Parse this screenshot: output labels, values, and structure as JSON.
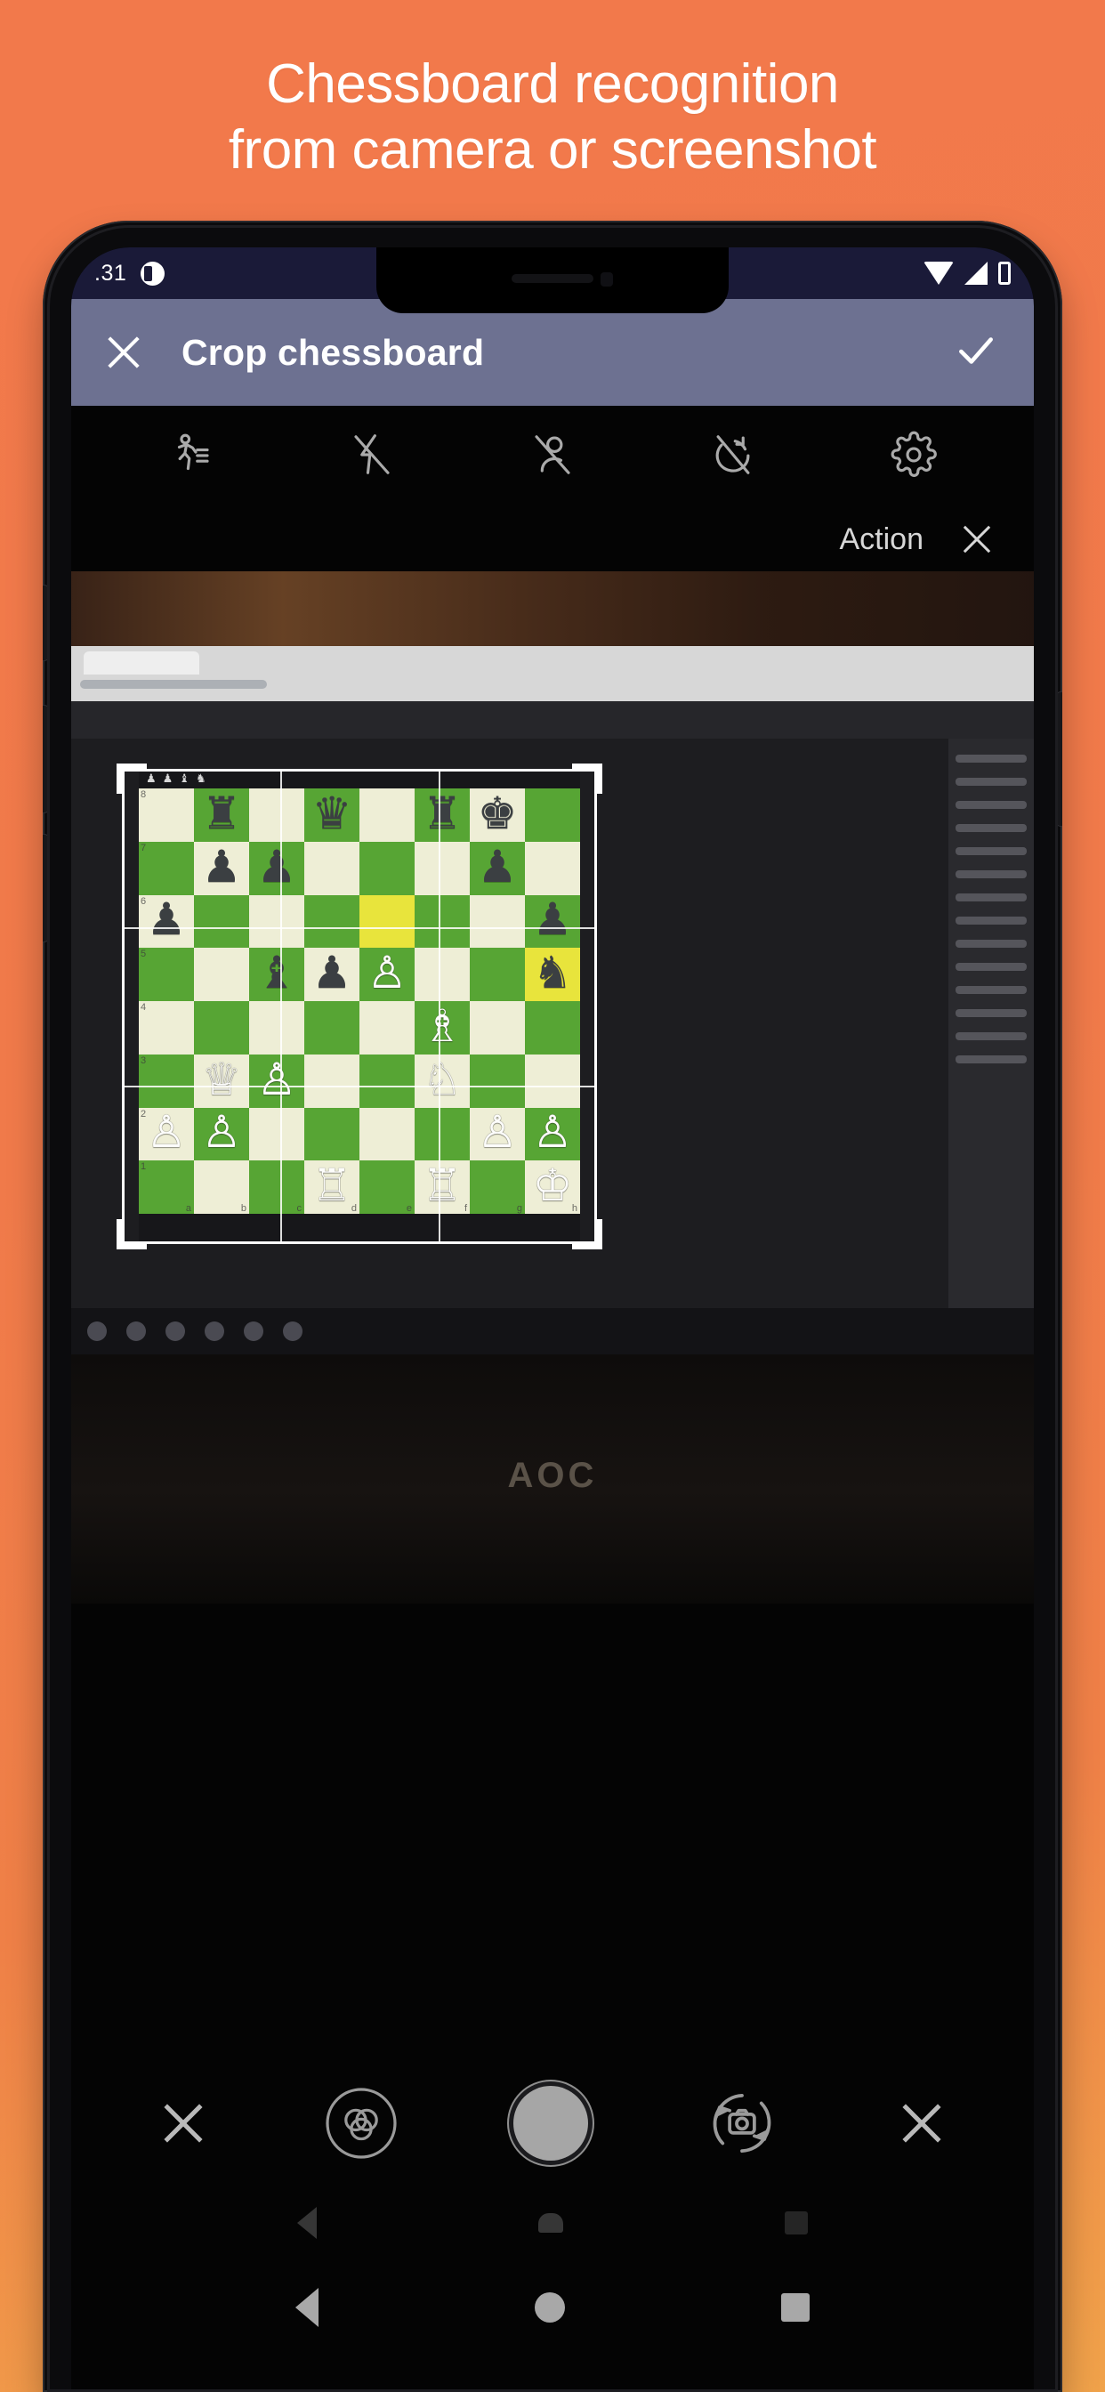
{
  "promo": {
    "line1": "Chessboard recognition",
    "line2": "from camera or screenshot",
    "background_color": "#f0794a",
    "text_color": "#ffffff"
  },
  "phone": {
    "status_bar": {
      "clock": ".31",
      "background_color": "#1a1a38",
      "left_icons": [
        "app-badge-icon"
      ],
      "right_icons": [
        "wifi-icon",
        "signal-icon",
        "battery-icon"
      ]
    },
    "app_bar": {
      "title": "Crop chessboard",
      "close_label": "close-icon",
      "confirm_label": "check-icon",
      "background_color": "#6d7191",
      "text_color": "#ffffff"
    },
    "camera_toolbar": {
      "items": [
        {
          "name": "motion-photo-off-icon"
        },
        {
          "name": "flash-off-icon"
        },
        {
          "name": "portrait-off-icon"
        },
        {
          "name": "timer-off-icon"
        },
        {
          "name": "settings-gear-icon"
        }
      ]
    },
    "action_row": {
      "label": "Action",
      "close_label": "close-icon"
    },
    "camera_controls": {
      "close_label": "close-icon",
      "filters_label": "filters-icon",
      "shutter_label": "shutter-button",
      "flip_label": "flip-camera-icon",
      "cancel_label": "close-icon"
    },
    "nav_bar": {
      "back_label": "back-triangle-icon",
      "home_label": "home-circle-icon",
      "recents_label": "recents-square-icon"
    }
  },
  "scene": {
    "monitor_brand": "AOC",
    "browser_url": "",
    "move_lines": 14,
    "taskbar_dots": 6
  },
  "crop": {
    "frame_color": "#ffffff",
    "grid": true
  },
  "chessboard": {
    "light_square_color": "#eeeed6",
    "dark_square_color": "#57a534",
    "highlight_color": "#e8e43c",
    "file_labels": [
      "a",
      "b",
      "c",
      "d",
      "e",
      "f",
      "g",
      "h"
    ],
    "rank_labels": [
      "8",
      "7",
      "6",
      "5",
      "4",
      "3",
      "2",
      "1"
    ],
    "captured_strip": [
      "♟",
      "♟",
      "♝",
      "♞"
    ],
    "highlighted_squares": [
      "e6",
      "h5"
    ],
    "ranks": [
      {
        "rank": "8",
        "squares": [
          {
            "piece": "",
            "color": ""
          },
          {
            "piece": "♜",
            "color": "black"
          },
          {
            "piece": "",
            "color": ""
          },
          {
            "piece": "♛",
            "color": "black"
          },
          {
            "piece": "",
            "color": ""
          },
          {
            "piece": "♜",
            "color": "black"
          },
          {
            "piece": "♚",
            "color": "black"
          },
          {
            "piece": "",
            "color": ""
          }
        ]
      },
      {
        "rank": "7",
        "squares": [
          {
            "piece": "",
            "color": ""
          },
          {
            "piece": "♟",
            "color": "black"
          },
          {
            "piece": "♟",
            "color": "black"
          },
          {
            "piece": "",
            "color": ""
          },
          {
            "piece": "",
            "color": ""
          },
          {
            "piece": "",
            "color": ""
          },
          {
            "piece": "♟",
            "color": "black"
          },
          {
            "piece": "",
            "color": ""
          }
        ]
      },
      {
        "rank": "6",
        "squares": [
          {
            "piece": "♟",
            "color": "black"
          },
          {
            "piece": "",
            "color": ""
          },
          {
            "piece": "",
            "color": ""
          },
          {
            "piece": "",
            "color": ""
          },
          {
            "piece": "",
            "color": "",
            "highlight": true
          },
          {
            "piece": "",
            "color": ""
          },
          {
            "piece": "",
            "color": ""
          },
          {
            "piece": "♟",
            "color": "black"
          }
        ]
      },
      {
        "rank": "5",
        "squares": [
          {
            "piece": "",
            "color": ""
          },
          {
            "piece": "",
            "color": ""
          },
          {
            "piece": "♝",
            "color": "black"
          },
          {
            "piece": "♟",
            "color": "black"
          },
          {
            "piece": "♙",
            "color": "white"
          },
          {
            "piece": "",
            "color": ""
          },
          {
            "piece": "",
            "color": ""
          },
          {
            "piece": "♞",
            "color": "black",
            "highlight": true
          }
        ]
      },
      {
        "rank": "4",
        "squares": [
          {
            "piece": "",
            "color": ""
          },
          {
            "piece": "",
            "color": ""
          },
          {
            "piece": "",
            "color": ""
          },
          {
            "piece": "",
            "color": ""
          },
          {
            "piece": "",
            "color": ""
          },
          {
            "piece": "♗",
            "color": "white"
          },
          {
            "piece": "",
            "color": ""
          },
          {
            "piece": "",
            "color": ""
          }
        ]
      },
      {
        "rank": "3",
        "squares": [
          {
            "piece": "",
            "color": ""
          },
          {
            "piece": "♕",
            "color": "white"
          },
          {
            "piece": "♙",
            "color": "white"
          },
          {
            "piece": "",
            "color": ""
          },
          {
            "piece": "",
            "color": ""
          },
          {
            "piece": "♘",
            "color": "white"
          },
          {
            "piece": "",
            "color": ""
          },
          {
            "piece": "",
            "color": ""
          }
        ]
      },
      {
        "rank": "2",
        "squares": [
          {
            "piece": "♙",
            "color": "white"
          },
          {
            "piece": "♙",
            "color": "white"
          },
          {
            "piece": "",
            "color": ""
          },
          {
            "piece": "",
            "color": ""
          },
          {
            "piece": "",
            "color": ""
          },
          {
            "piece": "",
            "color": ""
          },
          {
            "piece": "♙",
            "color": "white"
          },
          {
            "piece": "♙",
            "color": "white"
          }
        ]
      },
      {
        "rank": "1",
        "squares": [
          {
            "piece": "",
            "color": ""
          },
          {
            "piece": "",
            "color": ""
          },
          {
            "piece": "",
            "color": ""
          },
          {
            "piece": "♖",
            "color": "white"
          },
          {
            "piece": "",
            "color": ""
          },
          {
            "piece": "♖",
            "color": "white"
          },
          {
            "piece": "",
            "color": ""
          },
          {
            "piece": "♔",
            "color": "white"
          }
        ]
      }
    ]
  }
}
